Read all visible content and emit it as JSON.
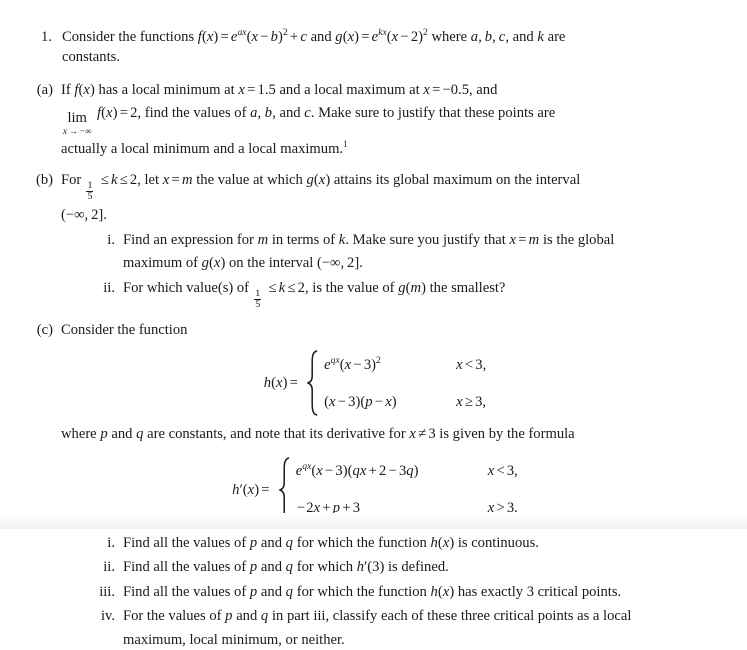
{
  "document": {
    "type": "calculus-problem-set",
    "problem_number": "1.",
    "intro": {
      "lead": "Consider the functions",
      "f_def": "f(x) = e^{ax}(x − b)^2 + c",
      "and": "and",
      "g_def": "g(x) = e^{kx}(x − 2)^2",
      "tail": "where a, b, c, and k are constants.",
      "tail_line2": "constants."
    },
    "parts": {
      "a": {
        "marker": "(a)",
        "line1_pre": "If",
        "line1_f": "f(x)",
        "line1_mid": "has a local minimum at",
        "line1_eq1": "x = 1.5",
        "line1_and": "and a local maximum at",
        "line1_eq2": "x = −0.5",
        "line1_end": ", and",
        "line2_lim": "lim",
        "line2_limsub": "x → −∞",
        "line2_fx": "f(x) = 2",
        "line2_rest": ", find the values of a, b, and c. Make sure to justify that these points are",
        "line3": "actually a local minimum and a local maximum.",
        "footnote_marker": "1"
      },
      "b": {
        "marker": "(b)",
        "line1_pre": "For",
        "frac_num": "1",
        "frac_den": "5",
        "line1_ineq": "≤ k ≤ 2",
        "line1_mid": ", let",
        "line1_xm": "x = m",
        "line1_rest": "the value at which g(x) attains its global maximum on the interval",
        "line2_interval": "(−∞, 2]",
        "line2_period": ".",
        "sub": [
          {
            "marker": "i.",
            "line1": "Find an expression for m in terms of k. Make sure you justify that x = m is the global",
            "line2": "maximum of g(x) on the interval (−∞, 2]."
          },
          {
            "marker": "ii.",
            "text_pre": "For which value(s) of",
            "frac_num": "1",
            "frac_den": "5",
            "text_ineq": "≤ k ≤ 2",
            "text_post": ", is the value of g(m) the smallest?"
          }
        ]
      },
      "c": {
        "marker": "(c)",
        "heading": "Consider the function",
        "h_equation": {
          "lhs": "h(x) =",
          "cases": [
            {
              "expr": "e^{qx}(x − 3)^2",
              "cond": "x < 3,"
            },
            {
              "expr": "(x − 3)(p − x)",
              "cond": "x ≥ 3,"
            }
          ]
        },
        "note": "where p and q are constants, and note that its derivative for x ≠ 3 is given by the formula",
        "hprime_equation": {
          "lhs": "h′(x) =",
          "cases": [
            {
              "expr": "e^{qx}(x − 3)(qx + 2 − 3q)",
              "cond": "x < 3,"
            },
            {
              "expr": "−2x + p + 3",
              "cond": "x > 3."
            }
          ]
        },
        "sub": [
          {
            "marker": "i.",
            "text": "Find all the values of p and q for which the function h(x) is continuous."
          },
          {
            "marker": "ii.",
            "text": "Find all the values of p and q for which h′(3) is defined."
          },
          {
            "marker": "iii.",
            "text": "Find all the values of p and q for which the function h(x) has exactly 3 critical points."
          },
          {
            "marker": "iv.",
            "text_line1": "For the values of p and q in part iii, classify each of these three critical points as a local",
            "text_line2": "maximum, local minimum, or neither."
          }
        ]
      }
    },
    "colors": {
      "background": "#ffffff",
      "text": "#1a1a1a"
    }
  }
}
